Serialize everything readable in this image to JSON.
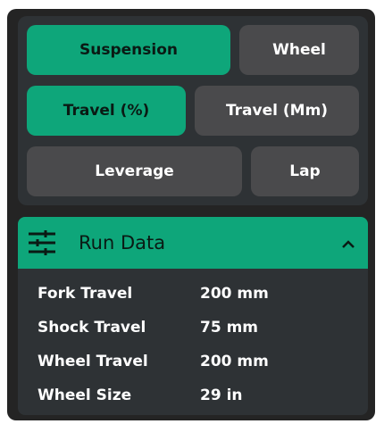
{
  "buttons": {
    "suspension": "Suspension",
    "wheel": "Wheel",
    "travel_percent": "Travel (%)",
    "travel_mm": "Travel (Mm)",
    "leverage": "Leverage",
    "lap": "Lap"
  },
  "section": {
    "title": "Run Data",
    "icon": "tune-sliders-icon",
    "toggle_icon": "chevron-up-icon"
  },
  "run_data": [
    {
      "label": "Fork Travel",
      "value": "200 mm"
    },
    {
      "label": "Shock Travel",
      "value": "75 mm"
    },
    {
      "label": "Wheel Travel",
      "value": "200 mm"
    },
    {
      "label": "Wheel Size",
      "value": "29 in"
    }
  ],
  "colors": {
    "accent": "#0ea67a",
    "panel": "#2e3235",
    "button_inactive": "#4a4a4c",
    "background": "#242424"
  }
}
